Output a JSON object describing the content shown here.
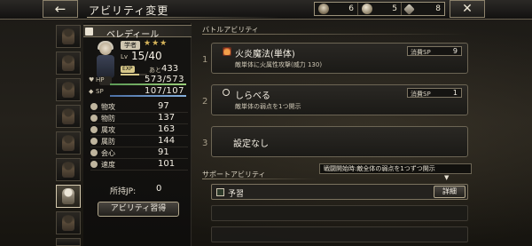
{
  "header": {
    "back_glyph": "←",
    "title": "アビリティ変更",
    "close_glyph": "✕"
  },
  "resources": [
    {
      "icon": "skull-icon",
      "value": "6"
    },
    {
      "icon": "crest-icon",
      "value": "5"
    },
    {
      "icon": "gem-icon",
      "value": "8"
    }
  ],
  "party": {
    "active_index": 6,
    "slots": 9
  },
  "character": {
    "name": "ベレディール",
    "job": "学者",
    "stars": "★★★",
    "lv_label": "Lv",
    "level": "15/40",
    "exp_label": "EXP",
    "exp_progress": 0.7,
    "next_label": "あと",
    "next_value": "433",
    "hp_label": "HP",
    "hp_value": "573/573",
    "hp_ratio": 1.0,
    "sp_label": "SP",
    "sp_value": "107/107",
    "sp_ratio": 1.0,
    "stats": [
      {
        "name": "物攻",
        "value": "97"
      },
      {
        "name": "物防",
        "value": "137"
      },
      {
        "name": "属攻",
        "value": "163"
      },
      {
        "name": "属防",
        "value": "144"
      },
      {
        "name": "会心",
        "value": "91"
      },
      {
        "name": "速度",
        "value": "101"
      }
    ],
    "jp_label": "所持JP:",
    "jp_value": "0",
    "learn_button": "アビリティ習得"
  },
  "battle_abilities": {
    "label": "バトルアビリティ",
    "slots": [
      {
        "num": "1",
        "icon": "fire-icon",
        "name": "火炎魔法(単体)",
        "desc": "敵単体に火属性攻撃(威力 130)",
        "sp_label": "消費SP",
        "sp": "9"
      },
      {
        "num": "2",
        "icon": "magnify-icon",
        "name": "しらべる",
        "desc": "敵単体の弱点を1つ開示",
        "sp_label": "消費SP",
        "sp": "1"
      },
      {
        "num": "3",
        "icon": "",
        "name": "設定なし",
        "desc": "",
        "sp_label": "",
        "sp": ""
      }
    ]
  },
  "support_abilities": {
    "label": "サポートアビリティ",
    "tooltip": "戦闘開始時:敵全体の弱点を1つずつ開示",
    "slots": [
      {
        "name": "予習",
        "detail_button": "詳細"
      }
    ]
  }
}
